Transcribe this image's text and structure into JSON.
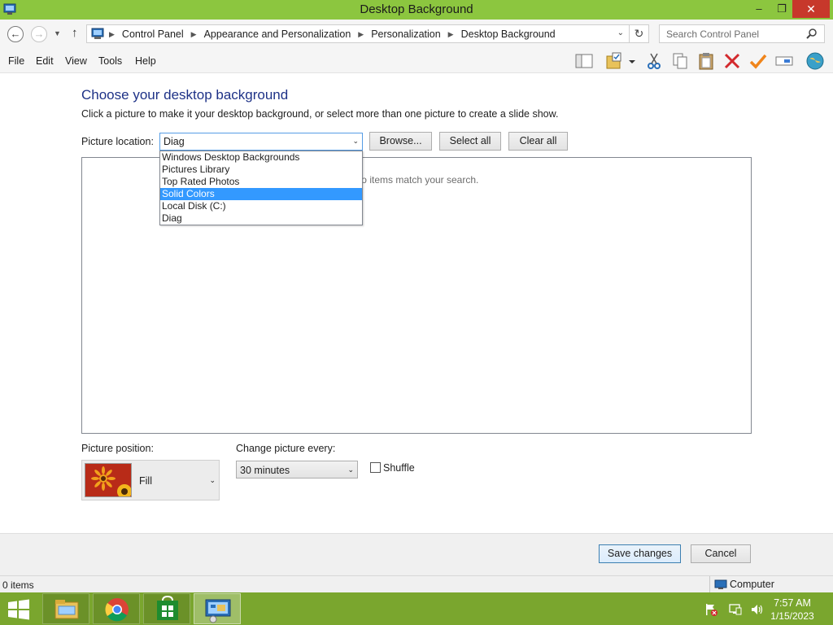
{
  "window": {
    "title": "Desktop Background",
    "minimize": "–",
    "maximize": "❐",
    "close": "✕"
  },
  "address_bar": {
    "back": "←",
    "forward": "→",
    "up": "↑",
    "breadcrumbs": [
      "Control Panel",
      "Appearance and Personalization",
      "Personalization",
      "Desktop Background"
    ],
    "breadcrumb_separator": "▶",
    "dropdown_arrow": "⌄",
    "refresh": "↻"
  },
  "search": {
    "placeholder": "Search Control Panel"
  },
  "menu": {
    "items": [
      "File",
      "Edit",
      "View",
      "Tools",
      "Help"
    ]
  },
  "toolbar": {
    "icons": [
      "layout-icon",
      "folder-check-icon",
      "cut-icon",
      "copy-icon",
      "paste-icon",
      "delete-icon",
      "checkmark-icon",
      "rename-icon",
      "globe-icon"
    ]
  },
  "page": {
    "heading": "Choose your desktop background",
    "subtext": "Click a picture to make it your desktop background, or select more than one picture to create a slide show.",
    "picture_location_label": "Picture location:",
    "picture_location_value": "Diag",
    "location_options": [
      "Windows Desktop Backgrounds",
      "Pictures Library",
      "Top Rated Photos",
      "Solid Colors",
      "Local Disk (C:)",
      "Diag"
    ],
    "highlighted_option": "Solid Colors",
    "browse_label": "Browse...",
    "select_all_label": "Select all",
    "clear_all_label": "Clear all",
    "no_items_text": "No items match your search.",
    "picture_position_label": "Picture position:",
    "picture_position_value": "Fill",
    "change_picture_label": "Change picture every:",
    "change_picture_value": "30 minutes",
    "shuffle_label": "Shuffle",
    "shuffle_checked": false,
    "combo_arrow": "⌄"
  },
  "footer": {
    "save_label": "Save changes",
    "cancel_label": "Cancel"
  },
  "status_bar": {
    "items_count": "0 items",
    "location": "Computer"
  },
  "taskbar": {
    "apps": [
      "file-explorer",
      "chrome",
      "store",
      "control-panel"
    ],
    "time": "7:57 AM",
    "date": "1/15/2023"
  },
  "colors": {
    "accent": "#8cc63f",
    "taskbar": "#7aa62e",
    "heading": "#1e3287",
    "selection": "#3399ff",
    "close_button": "#c7382b"
  }
}
